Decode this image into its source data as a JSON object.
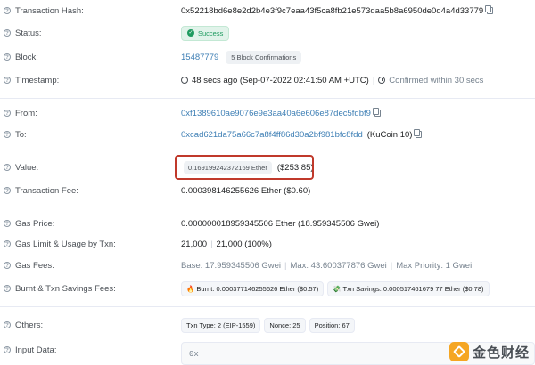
{
  "tx": {
    "hash_label": "Transaction Hash:",
    "hash": "0x52218bd6e8e2d2b4e3f9c7eaa43f5ca8fb21e573daa5b8a6950de0d4a4d33779",
    "status_label": "Status:",
    "status": "Success",
    "block_label": "Block:",
    "block": "15487779",
    "block_confirmations": "5 Block Confirmations",
    "timestamp_label": "Timestamp:",
    "timestamp": "48 secs ago (Sep-07-2022 02:41:50 AM +UTC)",
    "confirmed_within": "Confirmed within 30 secs",
    "from_label": "From:",
    "from": "0xf1389610ae9076e9e3aa40a6e606e87dec5fdbf9",
    "to_label": "To:",
    "to": "0xcad621da75a66c7a8f4ff86d30a2bf981bfc8fdd",
    "to_name": "(KuCoin 10)",
    "value_label": "Value:",
    "value": "0.169199242372169 Ether",
    "value_usd": "($253.85)",
    "fee_label": "Transaction Fee:",
    "fee": "0.000398146255626 Ether ($0.60)",
    "gas_price_label": "Gas Price:",
    "gas_price": "0.000000018959345506 Ether (18.959345506 Gwei)",
    "gas_limit_label": "Gas Limit & Usage by Txn:",
    "gas_limit": "21,000",
    "gas_usage": "21,000 (100%)",
    "gas_fees_label": "Gas Fees:",
    "gas_base": "Base: 17.959345506 Gwei",
    "gas_max": "Max: 43.600377876 Gwei",
    "gas_max_priority": "Max Priority: 1 Gwei",
    "burnt_label": "Burnt & Txn Savings Fees:",
    "burnt": "🔥 Burnt: 0.000377146255626 Ether ($0.57)",
    "savings": "💸 Txn Savings: 0.000517461679 77 Ether ($0.78)",
    "others_label": "Others:",
    "txn_type": "Txn Type: 2 (EIP-1559)",
    "nonce": "Nonce: 25",
    "position": "Position: 67",
    "input_label": "Input Data:",
    "input_data": "0x"
  },
  "watermark": {
    "text": "金色财经"
  }
}
